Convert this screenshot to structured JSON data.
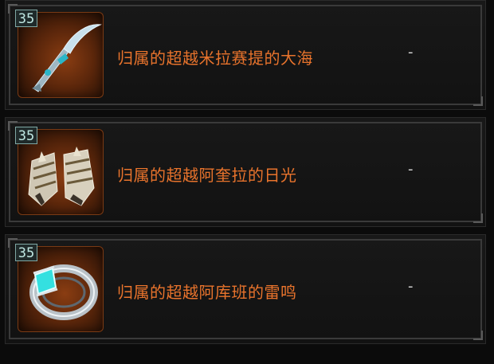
{
  "items": [
    {
      "level": "35",
      "name": "归属的超越米拉赛提的大海",
      "value": "-",
      "icon": "scythe-icon"
    },
    {
      "level": "35",
      "name": "归属的超越阿奎拉的日光",
      "value": "-",
      "icon": "gauntlets-icon"
    },
    {
      "level": "35",
      "name": "归属的超越阿库班的雷鸣",
      "value": "-",
      "icon": "ring-icon"
    }
  ],
  "colors": {
    "name_text": "#e8732c",
    "level_border": "#7fa8a4",
    "icon_bg": "#5a260b"
  }
}
